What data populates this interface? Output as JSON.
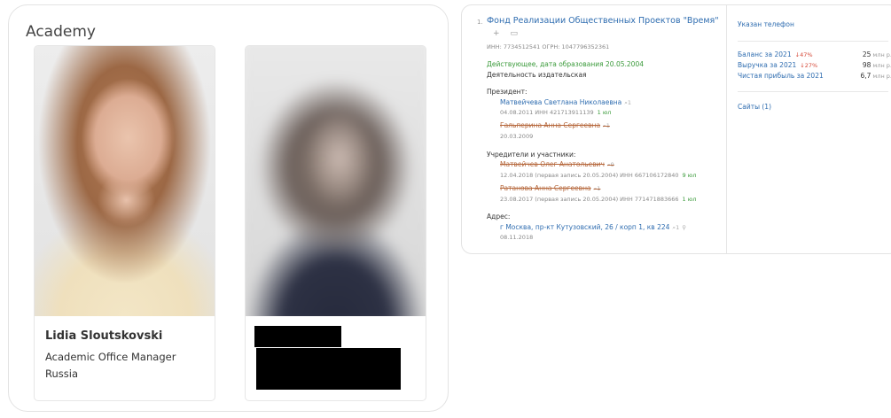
{
  "academy": {
    "title": "Academy",
    "cards": [
      {
        "name": "Lidia Sloutskovski",
        "role": "Academic Office Manager",
        "country": "Russia"
      },
      {
        "redacted": true
      }
    ]
  },
  "company": {
    "index": "1.",
    "title": "Фонд Реализации Общественных Проектов \"Время\"",
    "icons": [
      "plus-icon",
      "comment-icon"
    ],
    "ids": "ИНН: 7734512541   ОГРН: 1047796352361",
    "status": "Действующее, дата образования 20.05.2004",
    "activity": "Деятельность издательская",
    "president_label": "Президент:",
    "presidents": [
      {
        "name": "Матвейчева Светлана Николаевна",
        "q": "1",
        "meta": "04.08.2011   ИНН 421713911139",
        "share": "1 юл",
        "struck": false
      },
      {
        "name": "Гальперина Анна Сергеевна",
        "q": "1",
        "meta": "20.03.2009",
        "share": "",
        "struck": true
      }
    ],
    "founders_label": "Учредители и участники:",
    "founders": [
      {
        "name": "Матвейчев Олег Анатольевич",
        "q": "9",
        "meta": "12.04.2018 (первая запись 20.05.2004)   ИНН 667106172840",
        "share": "9 юл",
        "struck": true
      },
      {
        "name": "Ратанова Анна Сергеевна",
        "q": "1",
        "meta": "23.08.2017 (первая запись 20.05.2004)   ИНН 771471883666",
        "share": "1 юл",
        "struck": true
      }
    ],
    "address_label": "Адрес:",
    "address": "г Москва, пр-кт Кутузовский, 26 / корп 1, кв 224",
    "address_q": "1",
    "address_date": "08.11.2018",
    "side": {
      "phone": "Указан телефон",
      "finance": [
        {
          "label": "Баланс за 2021",
          "change": "47%",
          "value": "25",
          "unit": "млн р."
        },
        {
          "label": "Выручка за 2021",
          "change": "27%",
          "value": "98",
          "unit": "млн р."
        },
        {
          "label": "Чистая прибыль за 2021",
          "change": "",
          "value": "6,7",
          "unit": "млн р."
        }
      ],
      "sites": "Сайты (1)"
    },
    "colors": {
      "link": "#2f6db0",
      "active": "#3a9a3a",
      "struck": "#b5663a",
      "down": "#d64a3a"
    }
  }
}
